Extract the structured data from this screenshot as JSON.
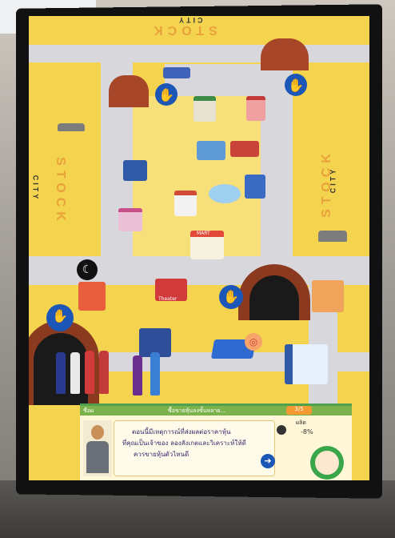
{
  "map": {
    "title_top": "STOCK",
    "subtitle_top": "CITY",
    "title_left": "STOCK",
    "subtitle_left": "CITY",
    "title_right": "STOCK",
    "subtitle_right": "CITY",
    "shop_signs": [
      "MART",
      "Theater"
    ]
  },
  "game_panel": {
    "header_left": "ชื่อผ",
    "header_center": "ซื้อขายหุ้นลงขั้นหลาย...",
    "turn_counter": "3/5",
    "stat_label": "ผลิต",
    "stat_value": "-8%",
    "dialog_line1": "ตอนนี้มีเหตุการณ์ที่ส่งผลต่อราคาหุ้น",
    "dialog_line2": "ที่คุณเป็นเจ้าของ ลองสังเกตและวิเคราะห์ให้ดี",
    "dialog_line3": "ควรขายหุ้นตัวไหนดี",
    "next_icon": "arrow-right-icon"
  },
  "colors": {
    "ground": "#f4d34f",
    "road": "#d7d7dc",
    "accent_blue": "#1c57b8",
    "arch_brown": "#8b3a1f",
    "panel_green": "#7bb24b"
  }
}
